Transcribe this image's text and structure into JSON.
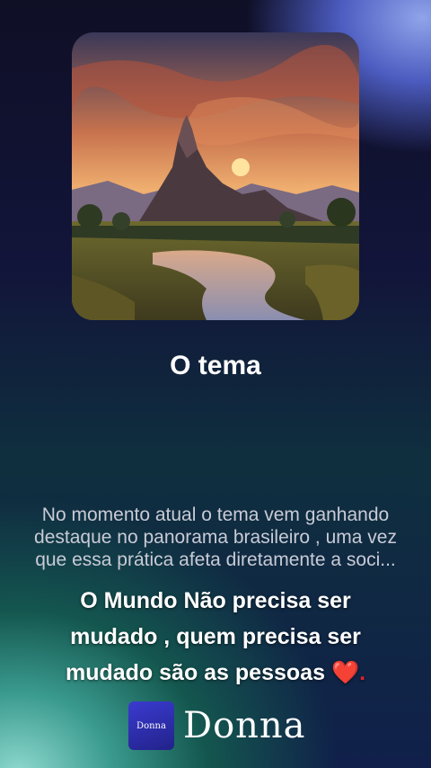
{
  "post": {
    "image_alt": "landscape painting of a mountain at sunset with a river",
    "title": "O tema",
    "description": "No momento atual o tema vem ganhando destaque no panorama brasileiro , uma vez que essa prática afeta diretamente a soci...",
    "quote": "O  Mundo Não precisa ser mudado , quem precisa ser mudado são as pessoas",
    "quote_emoji": "❤️."
  },
  "brand": {
    "logo_text": "Donna",
    "name": "Donna"
  }
}
